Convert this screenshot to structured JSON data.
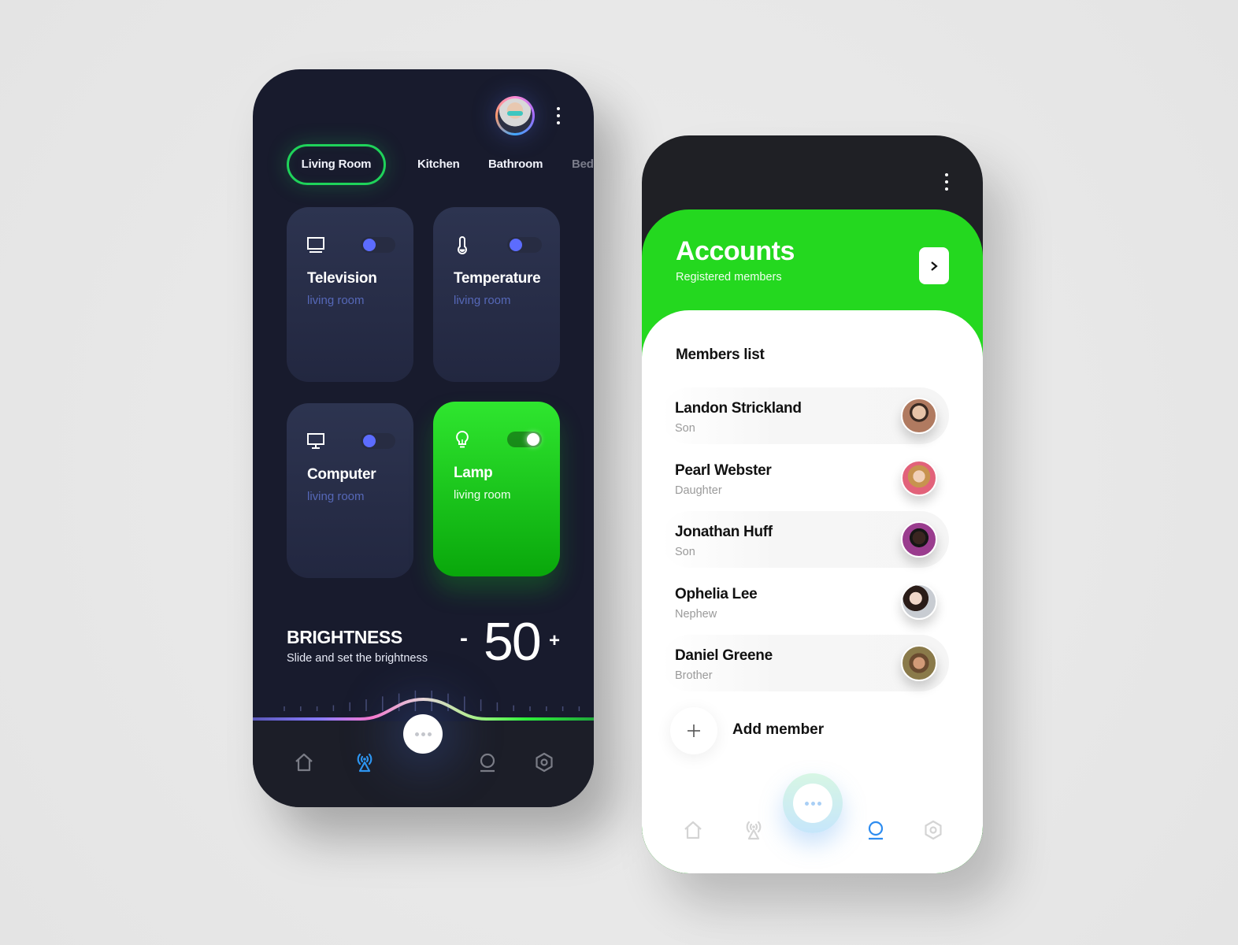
{
  "colors": {
    "dark_bg": "#181b2d",
    "accent_green": "#24d81f",
    "accent_blue": "#2d8cf0",
    "toggle_knob": "#5c6cff",
    "muted_room": "#5668b8"
  },
  "home_screen": {
    "menu_icon": "kebab-menu-icon",
    "room_tabs": [
      {
        "label": "Living Room",
        "active": true
      },
      {
        "label": "Kitchen",
        "active": false
      },
      {
        "label": "Bathroom",
        "active": false
      },
      {
        "label": "Bed",
        "active": false
      }
    ],
    "devices": [
      {
        "name": "Television",
        "room": "living room",
        "icon": "tv-icon",
        "on": false
      },
      {
        "name": "Temperature",
        "room": "living room",
        "icon": "thermometer-icon",
        "on": false
      },
      {
        "name": "Computer",
        "room": "living room",
        "icon": "monitor-icon",
        "on": false
      },
      {
        "name": "Lamp",
        "room": "living room",
        "icon": "lightbulb-icon",
        "on": true
      }
    ],
    "brightness": {
      "title": "BRIGHTNESS",
      "subtitle": "Slide and set the brightness",
      "minus": "-",
      "value": "50",
      "plus": "+",
      "level_percent": 50
    },
    "bottom_nav": [
      {
        "icon": "home-icon",
        "active": false
      },
      {
        "icon": "antenna-icon",
        "active": true
      },
      {
        "icon": "more-dots-icon",
        "active": false
      },
      {
        "icon": "user-icon",
        "active": false
      },
      {
        "icon": "settings-hex-icon",
        "active": false
      }
    ]
  },
  "accounts_screen": {
    "title": "Accounts",
    "subtitle": "Registered members",
    "next_icon": "chevron-right-icon",
    "list_title": "Members list",
    "members": [
      {
        "name": "Landon Strickland",
        "role": "Son"
      },
      {
        "name": "Pearl Webster",
        "role": "Daughter"
      },
      {
        "name": "Jonathan Huff",
        "role": "Son"
      },
      {
        "name": "Ophelia Lee",
        "role": "Nephew"
      },
      {
        "name": "Daniel Greene",
        "role": "Brother"
      }
    ],
    "add_member": {
      "icon": "plus-icon",
      "label": "Add member"
    },
    "bottom_nav": [
      {
        "icon": "home-icon",
        "active": false
      },
      {
        "icon": "antenna-icon",
        "active": false
      },
      {
        "icon": "more-dots-icon",
        "active": false
      },
      {
        "icon": "user-icon",
        "active": true
      },
      {
        "icon": "settings-hex-icon",
        "active": false
      }
    ]
  }
}
